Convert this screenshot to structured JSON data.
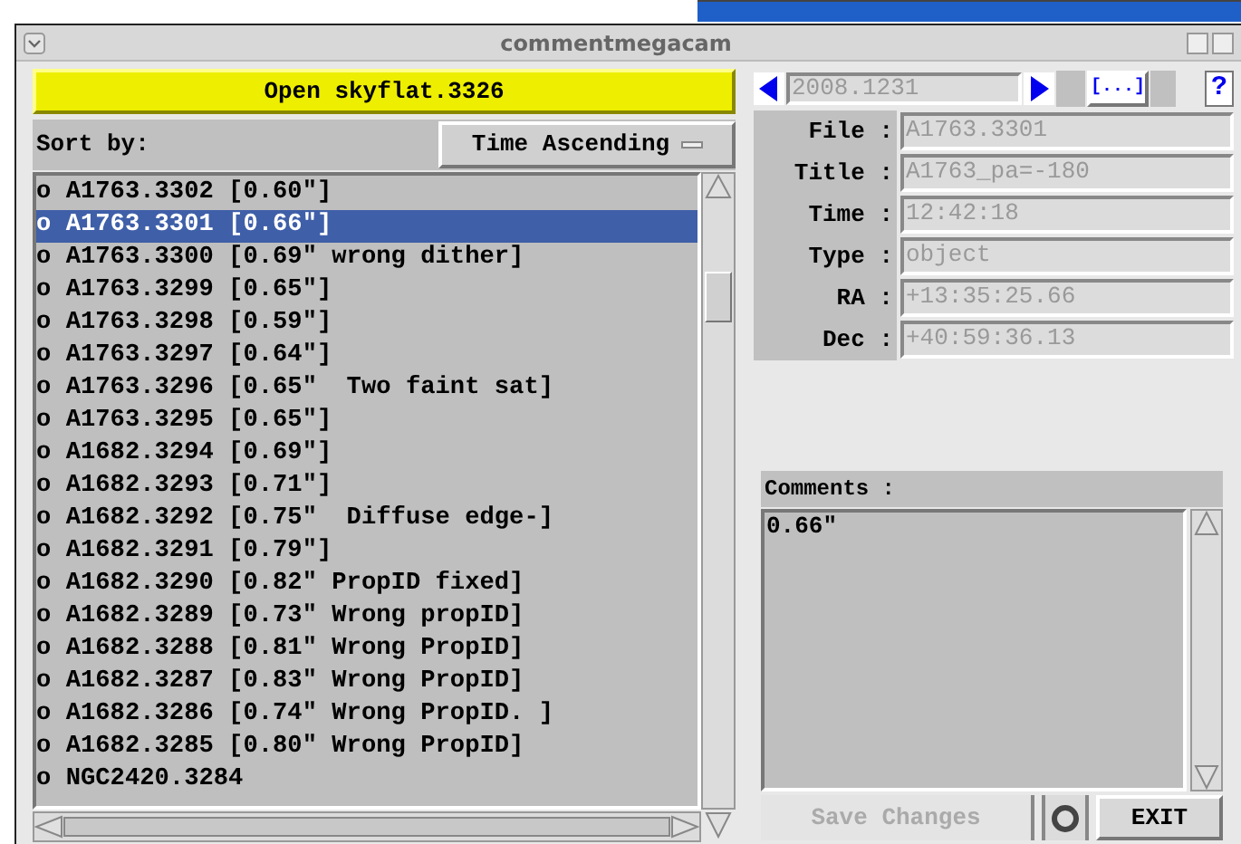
{
  "window": {
    "title": "commentmegacam"
  },
  "open_button": "Open skyflat.3326",
  "sort": {
    "label": "Sort by:",
    "value": "Time Ascending"
  },
  "list": [
    {
      "text": "o A1763.3302 [0.60\"]",
      "selected": false
    },
    {
      "text": "o A1763.3301 [0.66\"]",
      "selected": true
    },
    {
      "text": "o A1763.3300 [0.69\" wrong dither]",
      "selected": false
    },
    {
      "text": "o A1763.3299 [0.65\"]",
      "selected": false
    },
    {
      "text": "o A1763.3298 [0.59\"]",
      "selected": false
    },
    {
      "text": "o A1763.3297 [0.64\"]",
      "selected": false
    },
    {
      "text": "o A1763.3296 [0.65\"  Two faint sat]",
      "selected": false
    },
    {
      "text": "o A1763.3295 [0.65\"]",
      "selected": false
    },
    {
      "text": "o A1682.3294 [0.69\"]",
      "selected": false
    },
    {
      "text": "o A1682.3293 [0.71\"]",
      "selected": false
    },
    {
      "text": "o A1682.3292 [0.75\"  Diffuse edge-]",
      "selected": false
    },
    {
      "text": "o A1682.3291 [0.79\"]",
      "selected": false
    },
    {
      "text": "o A1682.3290 [0.82\" PropID fixed]",
      "selected": false
    },
    {
      "text": "o A1682.3289 [0.73\" Wrong propID]",
      "selected": false
    },
    {
      "text": "o A1682.3288 [0.81\" Wrong PropID]",
      "selected": false
    },
    {
      "text": "o A1682.3287 [0.83\" Wrong PropID]",
      "selected": false
    },
    {
      "text": "o A1682.3286 [0.74\" Wrong PropID. ]",
      "selected": false
    },
    {
      "text": "o A1682.3285 [0.80\" Wrong PropID]",
      "selected": false
    },
    {
      "text": "o NGC2420.3284",
      "selected": false
    }
  ],
  "nav": {
    "date": "2008.1231",
    "more": "[...]",
    "help": "?"
  },
  "fields": [
    {
      "label": "File :",
      "value": "A1763.3301",
      "disabled": true
    },
    {
      "label": "Title :",
      "value": "A1763_pa=-180",
      "disabled": true
    },
    {
      "label": "Time :",
      "value": "12:42:18",
      "disabled": true
    },
    {
      "label": "Type :",
      "value": "object",
      "disabled": true
    },
    {
      "label": "RA :",
      "value": "+13:35:25.66",
      "disabled": true
    },
    {
      "label": "Dec :",
      "value": "+40:59:36.13",
      "disabled": true
    }
  ],
  "comments": {
    "label": "Comments :",
    "value": "0.66\""
  },
  "buttons": [
    {
      "label": "Save Changes",
      "disabled": true
    },
    {
      "label": "EXIT",
      "disabled": false
    }
  ]
}
